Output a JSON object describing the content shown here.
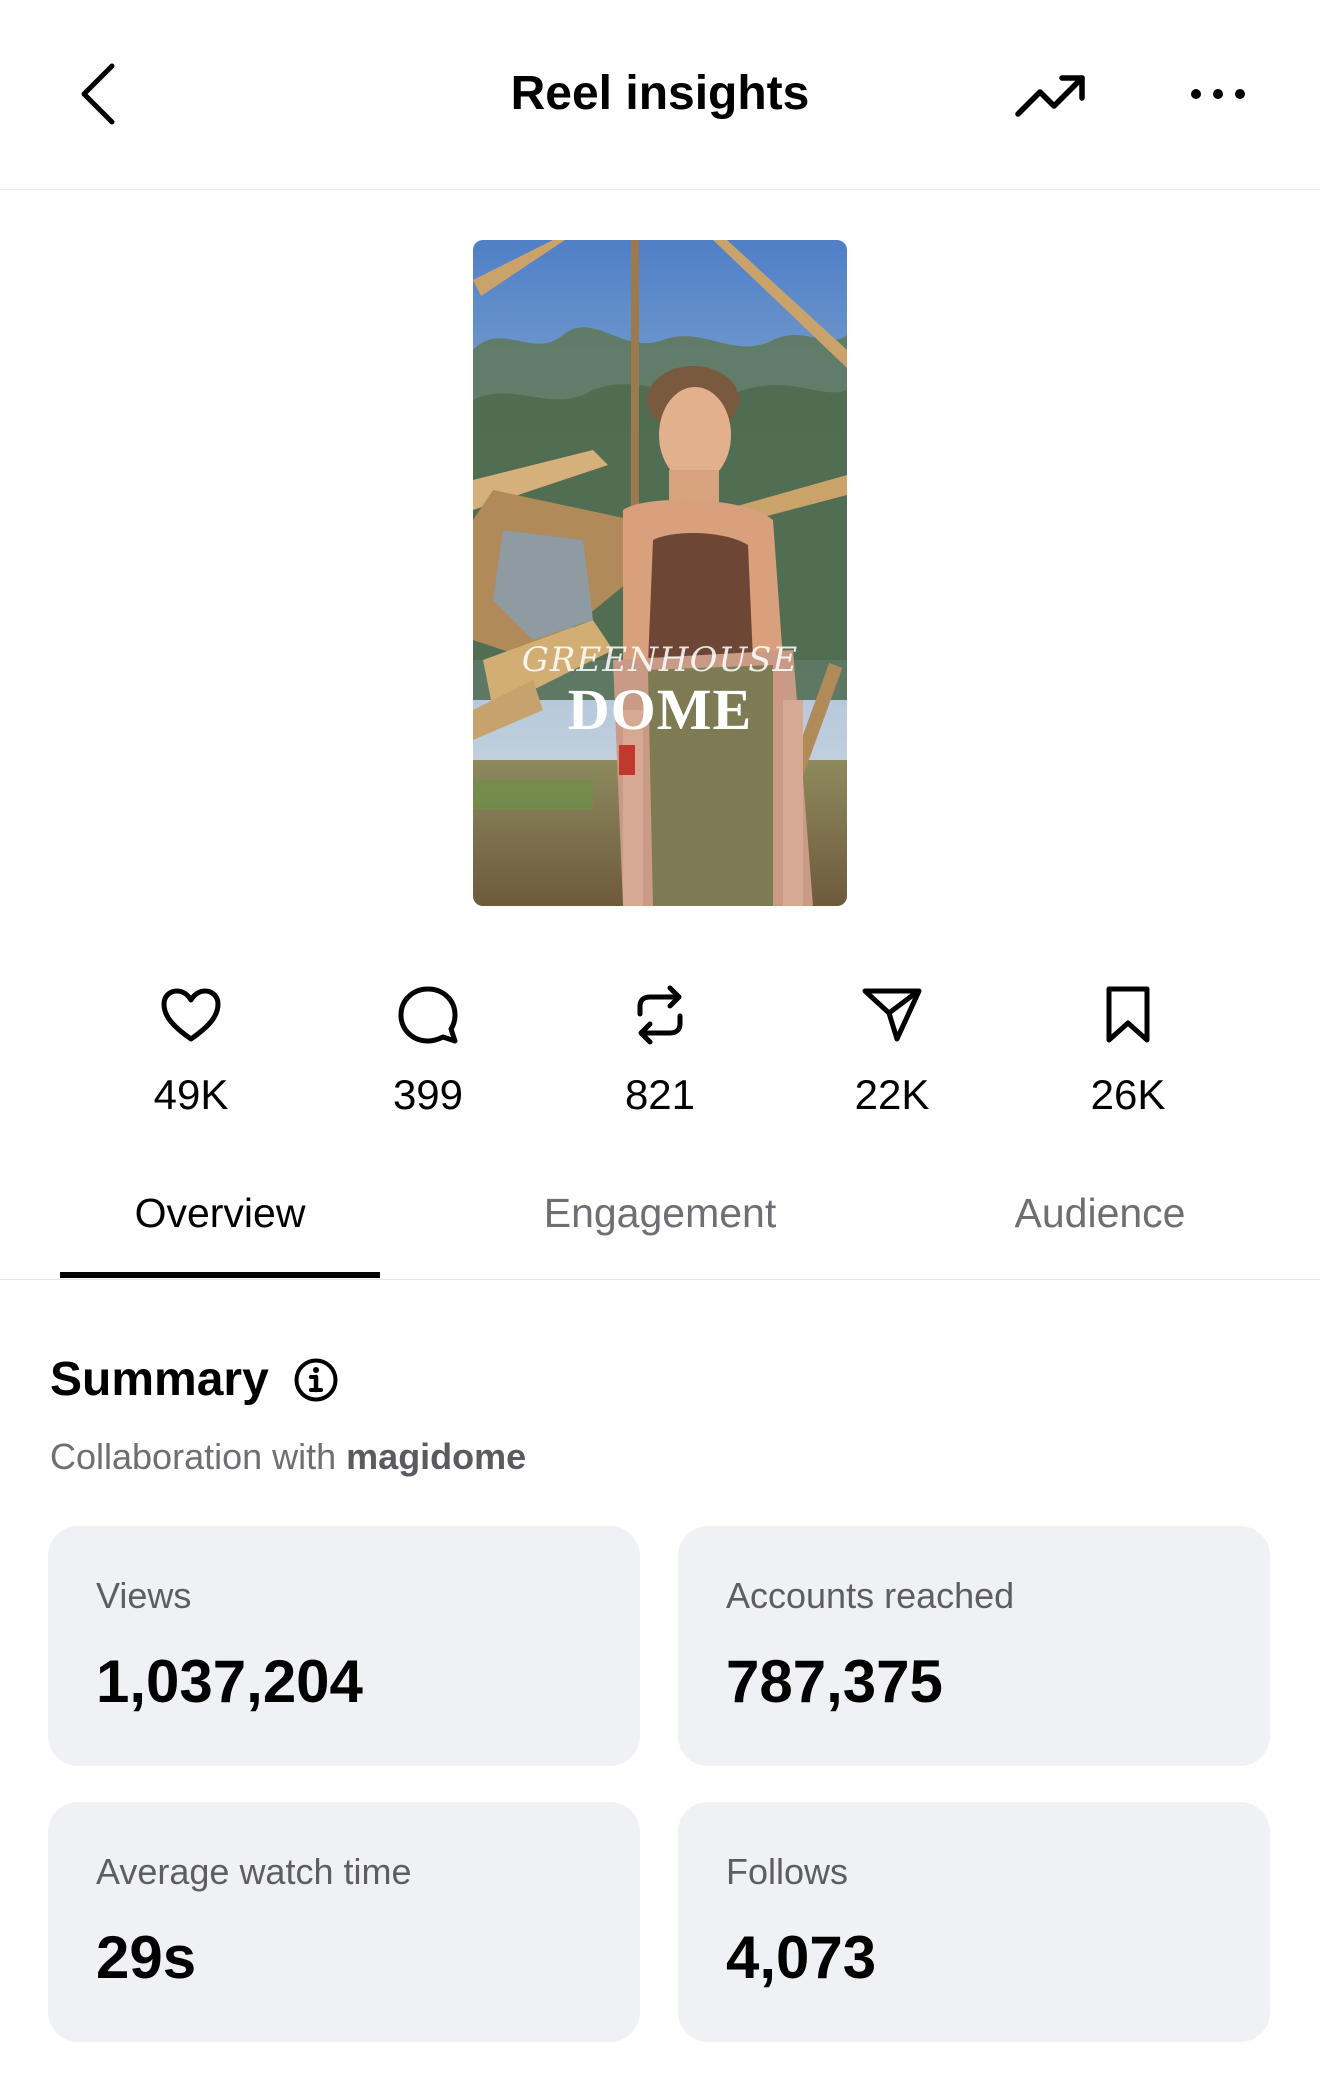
{
  "header": {
    "title": "Reel insights",
    "back_icon": "chevron-left-icon",
    "trend_icon": "trending-up-icon",
    "more_icon": "ellipsis-icon"
  },
  "reel": {
    "caption_top": "GREENHOUSE",
    "caption_main": "DOME"
  },
  "stats": [
    {
      "icon": "heart-icon",
      "value": "49K"
    },
    {
      "icon": "comment-icon",
      "value": "399"
    },
    {
      "icon": "repost-icon",
      "value": "821"
    },
    {
      "icon": "share-icon",
      "value": "22K"
    },
    {
      "icon": "bookmark-icon",
      "value": "26K"
    }
  ],
  "tabs": [
    {
      "label": "Overview",
      "active": true
    },
    {
      "label": "Engagement",
      "active": false
    },
    {
      "label": "Audience",
      "active": false
    }
  ],
  "summary": {
    "title": "Summary",
    "collab_prefix": "Collaboration with ",
    "collab_account": "magidome"
  },
  "cards": [
    {
      "label": "Views",
      "value": "1,037,204"
    },
    {
      "label": "Accounts reached",
      "value": "787,375"
    },
    {
      "label": "Average watch time",
      "value": "29s"
    },
    {
      "label": "Follows",
      "value": "4,073"
    }
  ]
}
